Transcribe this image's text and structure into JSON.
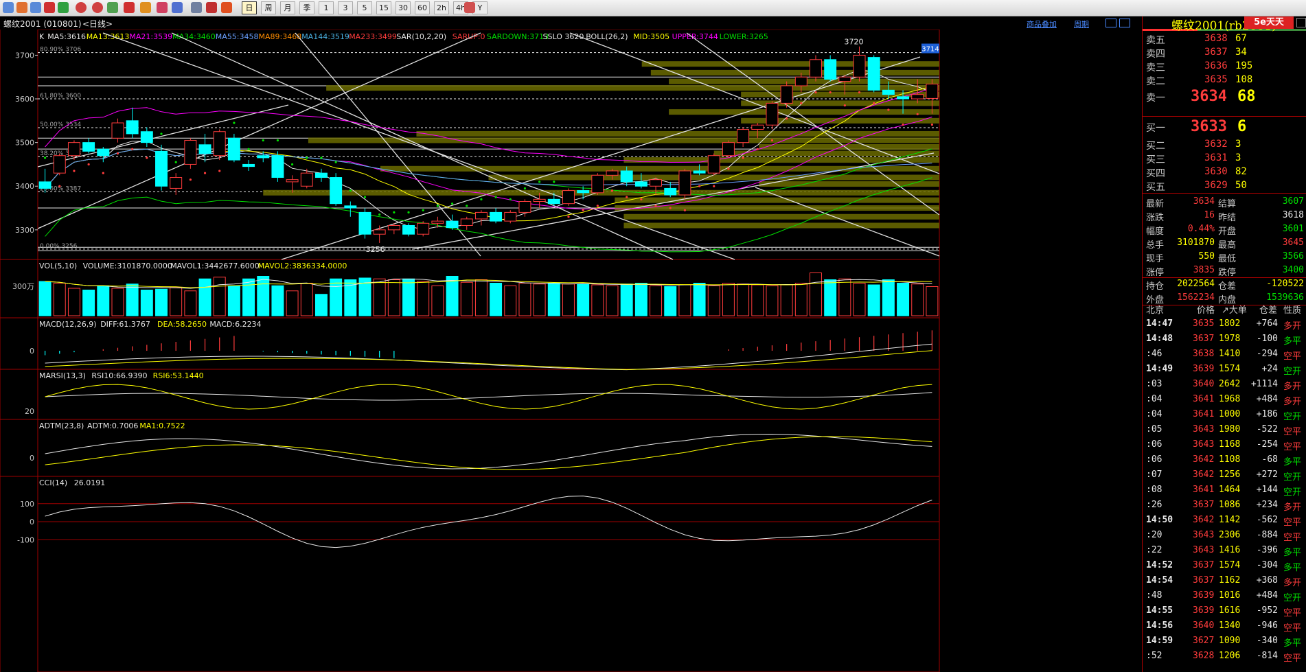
{
  "colors": {
    "up": "#ff3c3c",
    "down": "#00ffff",
    "yellow": "#ffff00",
    "green": "#00e000",
    "magenta": "#ff00ff",
    "grid": "#a00000"
  },
  "toolbar": {
    "period_buttons": [
      "日",
      "周",
      "月",
      "季",
      "1",
      "3",
      "5",
      "15",
      "30",
      "60",
      "2h",
      "4h",
      "Y"
    ],
    "active_period": "日"
  },
  "header": {
    "instrument": "螺纹2001 (010801)",
    "period": "<日线>",
    "links": [
      "商品叠加",
      "周期"
    ]
  },
  "main": {
    "legend": [
      {
        "text": "K",
        "color": "#e8e8e8"
      },
      {
        "text": "MA5:3616",
        "color": "#e8e8e8"
      },
      {
        "text": "MA13:3613",
        "color": "#ffff00"
      },
      {
        "text": "MA21:3539",
        "color": "#ff00ff"
      },
      {
        "text": "MA34:3460",
        "color": "#00e000"
      },
      {
        "text": "MA55:3458",
        "color": "#6aa0ff"
      },
      {
        "text": "MA89:3468",
        "color": "#ff8c00"
      },
      {
        "text": "MA144:3519",
        "color": "#4ab0e0"
      },
      {
        "text": "MA233:3499",
        "color": "#ff3c3c"
      },
      {
        "text": "SAR(10,2,20)",
        "color": "#e8e8e8"
      },
      {
        "text": "SARUP:0",
        "color": "#ff3c3c"
      },
      {
        "text": "SARDOWN:3713",
        "color": "#00e000"
      },
      {
        "text": "SSLO 3620",
        "color": "#e8e8e8"
      },
      {
        "text": "BOLL(26,2)",
        "color": "#e8e8e8"
      },
      {
        "text": "MID:3505",
        "color": "#ffff00"
      },
      {
        "text": "UPPER:3744",
        "color": "#ff00ff"
      },
      {
        "text": "LOWER:3265",
        "color": "#00e000"
      }
    ],
    "y_ticks": [
      "3700",
      "3600",
      "3500",
      "3400",
      "3300"
    ],
    "fib": [
      "80.90% 3706",
      "61.80% 3600",
      "50.00% 3534",
      "38.20% 3468",
      "23.60% 3387",
      "0.00% 3256"
    ],
    "high_label": "3720",
    "low_label": "3256",
    "last_price_tag": "3714"
  },
  "vol": {
    "legend": [
      {
        "text": "VOL(5,10)",
        "color": "#e8e8e8"
      },
      {
        "text": "VOLUME:3101870.0000",
        "color": "#e8e8e8"
      },
      {
        "text": "MAVOL1:3442677.6000",
        "color": "#e8e8e8"
      },
      {
        "text": "MAVOL2:3836334.0000",
        "color": "#ffff00"
      }
    ],
    "tick": "300万"
  },
  "macd": {
    "legend": [
      {
        "text": "MACD(12,26,9)",
        "color": "#e8e8e8"
      },
      {
        "text": "DIFF:61.3767",
        "color": "#e8e8e8"
      },
      {
        "text": "DEA:58.2650",
        "color": "#ffff00"
      },
      {
        "text": "MACD:6.2234",
        "color": "#e8e8e8"
      }
    ],
    "tick": "0"
  },
  "marsi": {
    "legend": [
      {
        "text": "MARSI(13,3)",
        "color": "#e8e8e8"
      },
      {
        "text": "RSI10:66.9390",
        "color": "#e8e8e8"
      },
      {
        "text": "RSI6:53.1440",
        "color": "#ffff00"
      }
    ],
    "tick": "20"
  },
  "adtm": {
    "legend": [
      {
        "text": "ADTM(23,8)",
        "color": "#e8e8e8"
      },
      {
        "text": "ADTM:0.7006",
        "color": "#e8e8e8"
      },
      {
        "text": "MA1:0.7522",
        "color": "#ffff00"
      }
    ],
    "tick": "0"
  },
  "cci": {
    "legend": [
      {
        "text": "CCI(14)",
        "color": "#e8e8e8"
      },
      {
        "text": "26.0191",
        "color": "#e8e8e8"
      }
    ],
    "ticks": [
      "100",
      "0",
      "-100"
    ]
  },
  "quote": {
    "title": "螺纹2001(rb2001)",
    "logo": "5e天天",
    "asks": [
      {
        "label": "卖五",
        "price": "3638",
        "vol": "67"
      },
      {
        "label": "卖四",
        "price": "3637",
        "vol": "34"
      },
      {
        "label": "卖三",
        "price": "3636",
        "vol": "195"
      },
      {
        "label": "卖二",
        "price": "3635",
        "vol": "108"
      },
      {
        "label": "卖一",
        "price": "3634",
        "vol": "68"
      }
    ],
    "bids": [
      {
        "label": "买一",
        "price": "3633",
        "vol": "6"
      },
      {
        "label": "买二",
        "price": "3632",
        "vol": "3"
      },
      {
        "label": "买三",
        "price": "3631",
        "vol": "3"
      },
      {
        "label": "买四",
        "price": "3630",
        "vol": "82"
      },
      {
        "label": "买五",
        "price": "3629",
        "vol": "50"
      }
    ],
    "stats": [
      {
        "l1": "最新",
        "v1": "3634",
        "c1": "red",
        "l2": "结算",
        "v2": "3607",
        "c2": "grn"
      },
      {
        "l1": "涨跌",
        "v1": "16",
        "c1": "red",
        "l2": "昨结",
        "v2": "3618",
        "c2": "wht"
      },
      {
        "l1": "幅度",
        "v1": "0.44%",
        "c1": "red",
        "l2": "开盘",
        "v2": "3601",
        "c2": "grn"
      },
      {
        "l1": "总手",
        "v1": "3101870",
        "c1": "yel",
        "l2": "最高",
        "v2": "3645",
        "c2": "red"
      },
      {
        "l1": "现手",
        "v1": "550",
        "c1": "yel",
        "l2": "最低",
        "v2": "3566",
        "c2": "grn"
      },
      {
        "l1": "涨停",
        "v1": "3835",
        "c1": "red",
        "l2": "跌停",
        "v2": "3400",
        "c2": "grn"
      },
      {
        "l1": "持仓",
        "v1": "2022564",
        "c1": "yel",
        "l2": "仓差",
        "v2": "-120522",
        "c2": "yel"
      },
      {
        "l1": "外盘",
        "v1": "1562234",
        "c1": "red",
        "l2": "内盘",
        "v2": "1539636",
        "c2": "grn"
      }
    ],
    "tick_header": {
      "city": "北京",
      "price": "价格",
      "big": "↗大单",
      "oi": "仓差",
      "nature": "性质"
    },
    "ticks": [
      {
        "t": "14:47",
        "p": "3635",
        "v": "1802",
        "d": "+764",
        "n": "多开"
      },
      {
        "t": "14:48",
        "p": "3637",
        "v": "1978",
        "d": "-100",
        "n": "多平"
      },
      {
        "t": ":46",
        "p": "3638",
        "v": "1410",
        "d": "-294",
        "n": "空平"
      },
      {
        "t": "14:49",
        "p": "3639",
        "v": "1574",
        "d": "+24",
        "n": "空开"
      },
      {
        "t": ":03",
        "p": "3640",
        "v": "2642",
        "d": "+1114",
        "n": "多开"
      },
      {
        "t": ":04",
        "p": "3641",
        "v": "1968",
        "d": "+484",
        "n": "多开"
      },
      {
        "t": ":04",
        "p": "3641",
        "v": "1000",
        "d": "+186",
        "n": "空开"
      },
      {
        "t": ":05",
        "p": "3643",
        "v": "1980",
        "d": "-522",
        "n": "空平"
      },
      {
        "t": ":06",
        "p": "3643",
        "v": "1168",
        "d": "-254",
        "n": "空平"
      },
      {
        "t": ":06",
        "p": "3642",
        "v": "1108",
        "d": "-68",
        "n": "多平"
      },
      {
        "t": ":07",
        "p": "3642",
        "v": "1256",
        "d": "+272",
        "n": "空开"
      },
      {
        "t": ":08",
        "p": "3641",
        "v": "1464",
        "d": "+144",
        "n": "空开"
      },
      {
        "t": ":26",
        "p": "3637",
        "v": "1086",
        "d": "+234",
        "n": "多开"
      },
      {
        "t": "14:50",
        "p": "3642",
        "v": "1142",
        "d": "-562",
        "n": "空平"
      },
      {
        "t": ":20",
        "p": "3643",
        "v": "2306",
        "d": "-884",
        "n": "空平"
      },
      {
        "t": ":22",
        "p": "3643",
        "v": "1416",
        "d": "-396",
        "n": "多平"
      },
      {
        "t": "14:52",
        "p": "3637",
        "v": "1574",
        "d": "-304",
        "n": "多平"
      },
      {
        "t": "14:54",
        "p": "3637",
        "v": "1162",
        "d": "+368",
        "n": "多开"
      },
      {
        "t": ":48",
        "p": "3639",
        "v": "1016",
        "d": "+484",
        "n": "空开"
      },
      {
        "t": "14:55",
        "p": "3639",
        "v": "1616",
        "d": "-952",
        "n": "空平"
      },
      {
        "t": "14:56",
        "p": "3640",
        "v": "1340",
        "d": "-946",
        "n": "空平"
      },
      {
        "t": "14:59",
        "p": "3627",
        "v": "1090",
        "d": "-340",
        "n": "多平"
      },
      {
        "t": ":52",
        "p": "3628",
        "v": "1206",
        "d": "-814",
        "n": "空平"
      }
    ]
  },
  "chart_data": {
    "type": "candlestick",
    "ylim": [
      3240,
      3740
    ],
    "ohlc": [
      [
        3410,
        3440,
        3385,
        3395
      ],
      [
        3430,
        3475,
        3425,
        3470
      ],
      [
        3470,
        3505,
        3460,
        3500
      ],
      [
        3500,
        3510,
        3475,
        3480
      ],
      [
        3485,
        3490,
        3455,
        3470
      ],
      [
        3510,
        3555,
        3500,
        3545
      ],
      [
        3550,
        3580,
        3510,
        3520
      ],
      [
        3525,
        3535,
        3490,
        3500
      ],
      [
        3480,
        3495,
        3390,
        3400
      ],
      [
        3395,
        3430,
        3380,
        3420
      ],
      [
        3450,
        3510,
        3440,
        3505
      ],
      [
        3495,
        3520,
        3455,
        3475
      ],
      [
        3470,
        3530,
        3460,
        3525
      ],
      [
        3510,
        3520,
        3455,
        3460
      ],
      [
        3450,
        3460,
        3435,
        3445
      ],
      [
        3470,
        3480,
        3455,
        3465
      ],
      [
        3470,
        3480,
        3410,
        3420
      ],
      [
        3410,
        3425,
        3385,
        3415
      ],
      [
        3400,
        3440,
        3395,
        3430
      ],
      [
        3430,
        3440,
        3410,
        3420
      ],
      [
        3420,
        3430,
        3355,
        3360
      ],
      [
        3355,
        3365,
        3330,
        3350
      ],
      [
        3340,
        3350,
        3280,
        3290
      ],
      [
        3290,
        3310,
        3270,
        3300
      ],
      [
        3300,
        3315,
        3290,
        3310
      ],
      [
        3310,
        3315,
        3285,
        3290
      ],
      [
        3290,
        3320,
        3285,
        3315
      ],
      [
        3315,
        3330,
        3305,
        3320
      ],
      [
        3320,
        3335,
        3300,
        3305
      ],
      [
        3310,
        3330,
        3300,
        3325
      ],
      [
        3325,
        3345,
        3310,
        3340
      ],
      [
        3340,
        3350,
        3315,
        3320
      ],
      [
        3320,
        3345,
        3315,
        3340
      ],
      [
        3340,
        3370,
        3330,
        3365
      ],
      [
        3365,
        3385,
        3350,
        3370
      ],
      [
        3370,
        3385,
        3355,
        3360
      ],
      [
        3360,
        3395,
        3355,
        3390
      ],
      [
        3390,
        3400,
        3370,
        3385
      ],
      [
        3385,
        3430,
        3380,
        3425
      ],
      [
        3425,
        3440,
        3415,
        3435
      ],
      [
        3435,
        3445,
        3400,
        3410
      ],
      [
        3410,
        3430,
        3395,
        3400
      ],
      [
        3400,
        3420,
        3380,
        3415
      ],
      [
        3395,
        3410,
        3375,
        3380
      ],
      [
        3380,
        3440,
        3370,
        3435
      ],
      [
        3435,
        3450,
        3425,
        3430
      ],
      [
        3430,
        3475,
        3425,
        3470
      ],
      [
        3470,
        3505,
        3465,
        3500
      ],
      [
        3500,
        3535,
        3490,
        3530
      ],
      [
        3530,
        3545,
        3510,
        3540
      ],
      [
        3540,
        3595,
        3530,
        3590
      ],
      [
        3590,
        3640,
        3580,
        3630
      ],
      [
        3630,
        3660,
        3615,
        3650
      ],
      [
        3650,
        3700,
        3640,
        3690
      ],
      [
        3690,
        3700,
        3640,
        3645
      ],
      [
        3640,
        3655,
        3610,
        3650
      ],
      [
        3650,
        3720,
        3640,
        3700
      ],
      [
        3695,
        3700,
        3615,
        3620
      ],
      [
        3620,
        3640,
        3600,
        3610
      ],
      [
        3605,
        3620,
        3566,
        3600
      ],
      [
        3600,
        3645,
        3590,
        3610
      ],
      [
        3601,
        3645,
        3566,
        3634
      ]
    ],
    "volume": [
      400,
      380,
      320,
      300,
      350,
      320,
      370,
      300,
      310,
      330,
      290,
      430,
      450,
      350,
      430,
      460,
      350,
      290,
      380,
      250,
      430,
      420,
      440,
      430,
      420,
      430,
      400,
      350,
      460,
      390,
      420,
      380,
      350,
      380,
      370,
      380,
      370,
      370,
      360,
      350,
      370,
      380,
      350,
      340,
      360,
      380,
      350,
      380,
      370,
      360,
      350,
      360,
      380,
      500,
      420,
      430,
      380,
      360,
      420,
      380,
      370,
      340
    ]
  }
}
